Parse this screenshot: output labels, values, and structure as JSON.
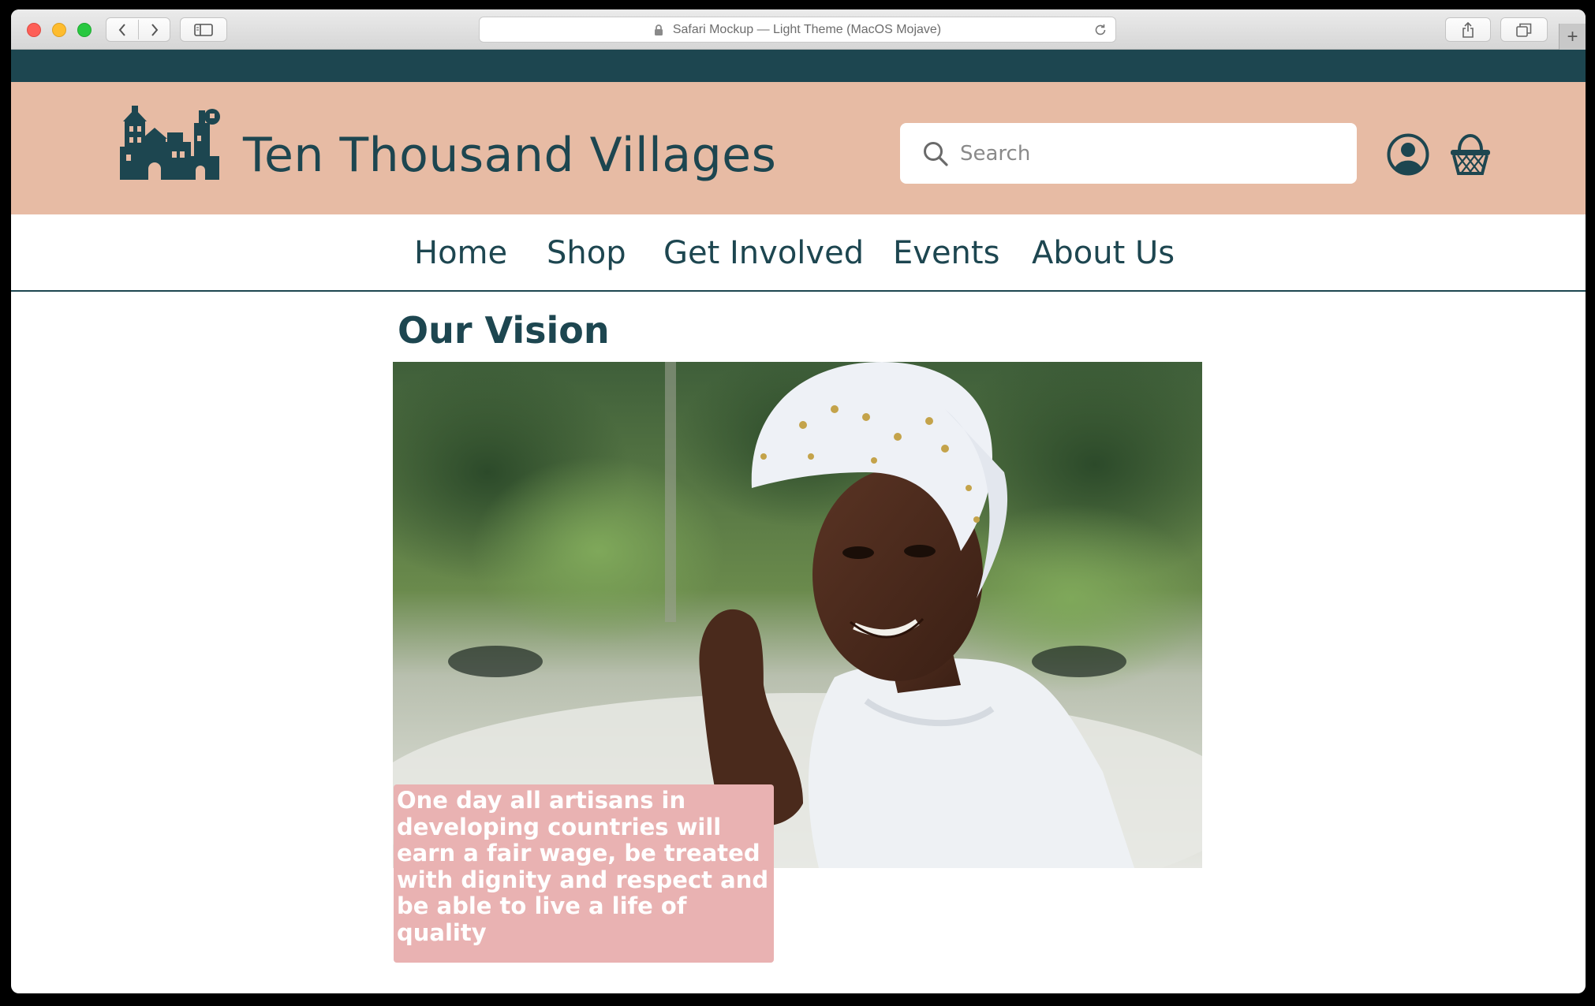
{
  "browser": {
    "address_text": "Safari Mockup — Light Theme (MacOS Mojave)",
    "icons": [
      "back-icon",
      "forward-icon",
      "sidebar-icon",
      "lock-icon",
      "reload-icon",
      "share-icon",
      "tabs-icon",
      "plus-icon"
    ]
  },
  "header": {
    "site_title": "Ten Thousand Villages",
    "search_placeholder": "Search",
    "colors": {
      "primary": "#1d4650",
      "header_bg": "#e7bba4",
      "caption_bg": "#e9b2b2"
    }
  },
  "nav": {
    "items": [
      {
        "label": "Home"
      },
      {
        "label": "Shop"
      },
      {
        "label": "Get Involved"
      },
      {
        "label": "Events"
      },
      {
        "label": "About Us"
      }
    ]
  },
  "main": {
    "heading": "Our Vision",
    "caption": "One day all artisans in developing countries will earn a fair wage, be treated with dignity and respect and be able to live a life of quality"
  }
}
